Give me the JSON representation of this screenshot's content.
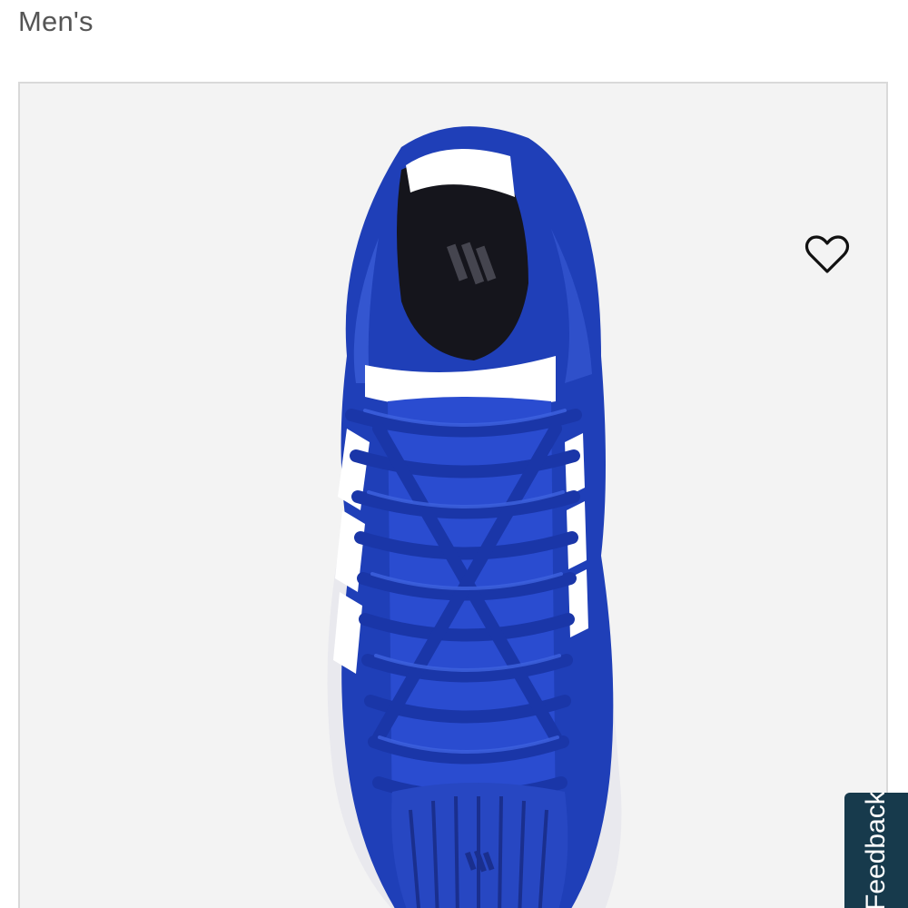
{
  "product": {
    "category": "Men's",
    "image_icon": "basketball-shoe-top-view",
    "colors": {
      "primary": "#1f3fb8",
      "accent": "#ffffff"
    }
  },
  "wishlist": {
    "icon": "heart-outline-icon"
  },
  "feedback": {
    "label": "Feedback",
    "background": "#173a4c"
  }
}
